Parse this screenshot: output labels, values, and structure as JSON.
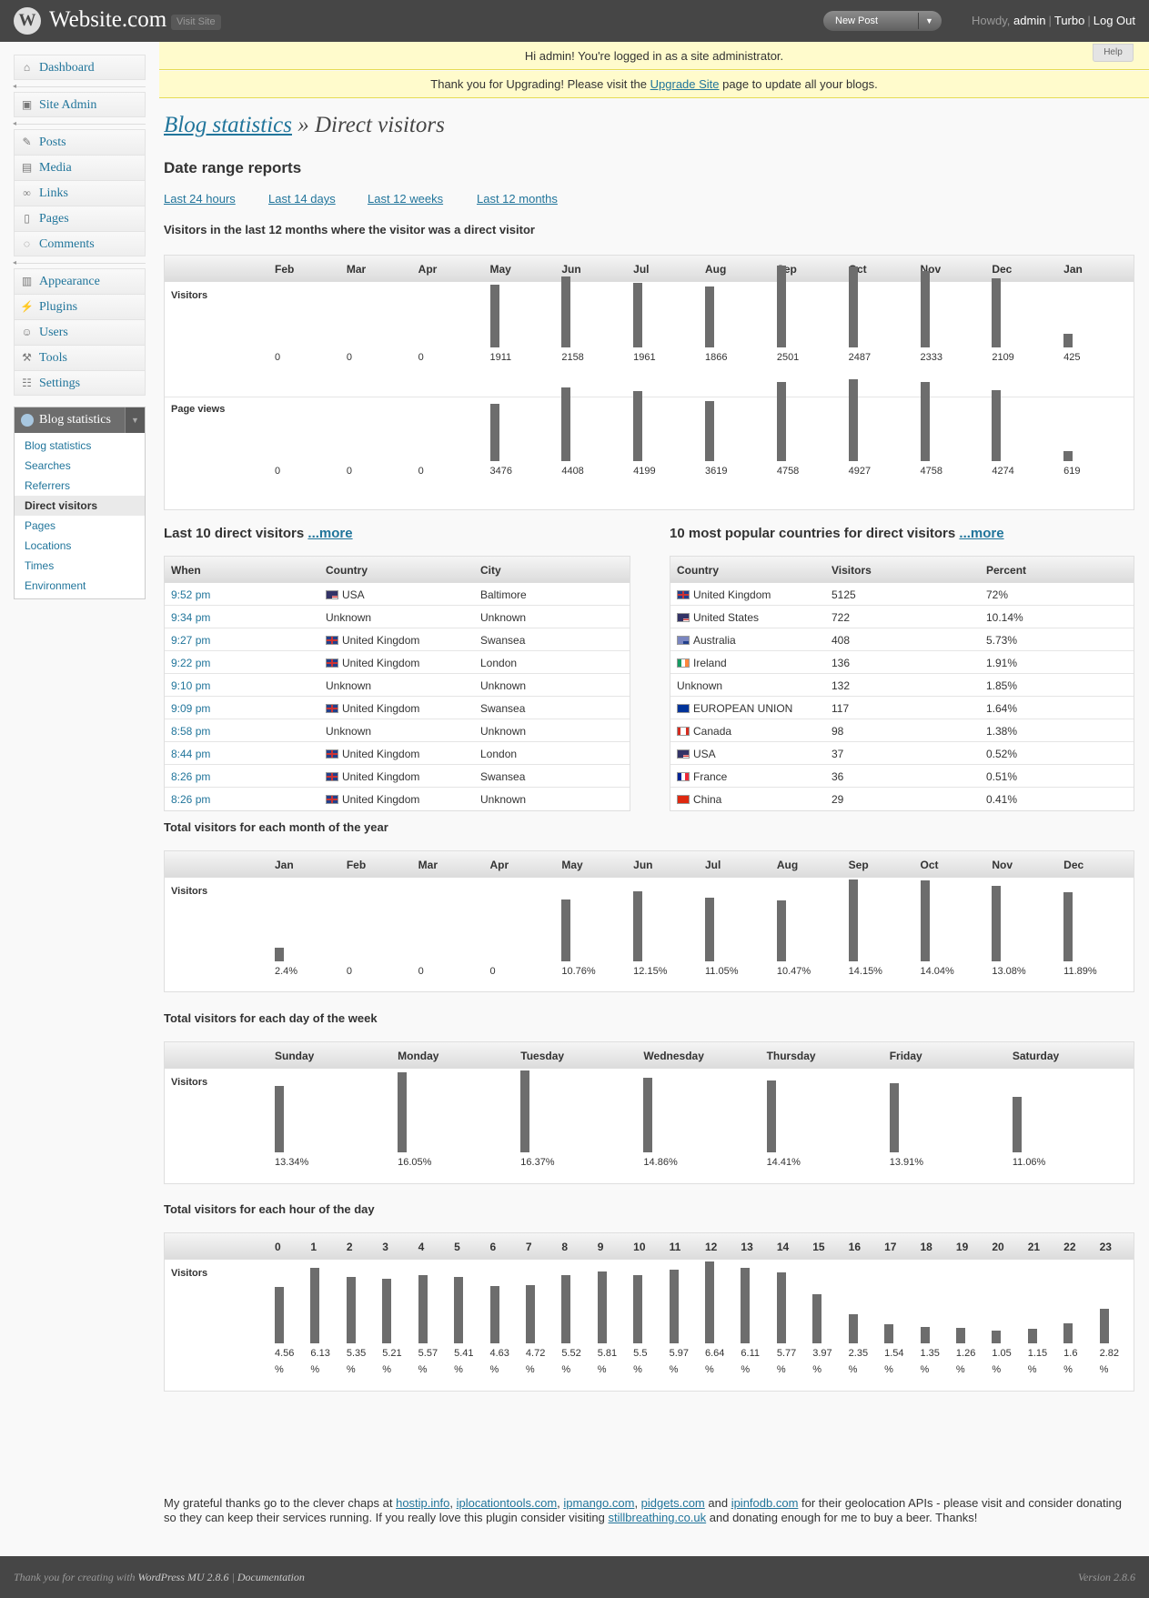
{
  "header": {
    "logo": "W",
    "site_title": "Website.com",
    "visit_site": "Visit Site",
    "new_post": "New Post",
    "howdy": "Howdy,",
    "user": "admin",
    "turbo": "Turbo",
    "logout": "Log Out"
  },
  "nav": {
    "dashboard": "Dashboard",
    "site_admin": "Site Admin",
    "posts": "Posts",
    "media": "Media",
    "links": "Links",
    "pages": "Pages",
    "comments": "Comments",
    "appearance": "Appearance",
    "plugins": "Plugins",
    "users": "Users",
    "tools": "Tools",
    "settings": "Settings",
    "blog_statistics": "Blog statistics",
    "sub": [
      "Blog statistics",
      "Searches",
      "Referrers",
      "Direct visitors",
      "Pages",
      "Locations",
      "Times",
      "Environment"
    ]
  },
  "notices": {
    "admin": "Hi admin! You're logged in as a site administrator.",
    "upgrade_pre": "Thank you for Upgrading! Please visit the ",
    "upgrade_link": "Upgrade Site",
    "upgrade_post": " page to update all your blogs.",
    "help": "Help"
  },
  "page": {
    "title_link": "Blog statistics",
    "title_rest": " » Direct visitors",
    "date_range_heading": "Date range reports",
    "ranges": [
      "Last 24 hours",
      "Last 14 days",
      "Last 12 weeks",
      "Last 12 months"
    ],
    "chart1_heading": "Visitors in the last 12 months where the visitor was a direct visitor",
    "last10_heading": "Last 10 direct visitors ",
    "countries_heading": "10 most popular countries for direct visitors ",
    "more": "...more",
    "month_heading": "Total visitors for each month of the year",
    "week_heading": "Total visitors for each day of the week",
    "hour_heading": "Total visitors for each hour of the day",
    "visitors_label": "Visitors",
    "pageviews_label": "Page views"
  },
  "chart_data": [
    {
      "type": "bar",
      "categories": [
        "Feb",
        "Mar",
        "Apr",
        "May",
        "Jun",
        "Jul",
        "Aug",
        "Sep",
        "Oct",
        "Nov",
        "Dec",
        "Jan"
      ],
      "series": [
        {
          "name": "Visitors",
          "values": [
            0,
            0,
            0,
            1911,
            2158,
            1961,
            1866,
            2501,
            2487,
            2333,
            2109,
            425
          ]
        },
        {
          "name": "Page views",
          "values": [
            0,
            0,
            0,
            3476,
            4408,
            4199,
            3619,
            4758,
            4927,
            4758,
            4274,
            619
          ]
        }
      ]
    },
    {
      "type": "bar",
      "categories": [
        "Jan",
        "Feb",
        "Mar",
        "Apr",
        "May",
        "Jun",
        "Jul",
        "Aug",
        "Sep",
        "Oct",
        "Nov",
        "Dec"
      ],
      "series": [
        {
          "name": "Visitors",
          "values": [
            2.4,
            0,
            0,
            0,
            10.76,
            12.15,
            11.05,
            10.47,
            14.15,
            14.04,
            13.08,
            11.89
          ],
          "labels": [
            "2.4%",
            "0",
            "0",
            "0",
            "10.76%",
            "12.15%",
            "11.05%",
            "10.47%",
            "14.15%",
            "14.04%",
            "13.08%",
            "11.89%"
          ]
        }
      ]
    },
    {
      "type": "bar",
      "categories": [
        "Sunday",
        "Monday",
        "Tuesday",
        "Wednesday",
        "Thursday",
        "Friday",
        "Saturday"
      ],
      "series": [
        {
          "name": "Visitors",
          "values": [
            13.34,
            16.05,
            16.37,
            14.86,
            14.41,
            13.91,
            11.06
          ],
          "labels": [
            "13.34%",
            "16.05%",
            "16.37%",
            "14.86%",
            "14.41%",
            "13.91%",
            "11.06%"
          ]
        }
      ]
    },
    {
      "type": "bar",
      "categories": [
        "0",
        "1",
        "2",
        "3",
        "4",
        "5",
        "6",
        "7",
        "8",
        "9",
        "10",
        "11",
        "12",
        "13",
        "14",
        "15",
        "16",
        "17",
        "18",
        "19",
        "20",
        "21",
        "22",
        "23"
      ],
      "series": [
        {
          "name": "Visitors",
          "values": [
            4.56,
            6.13,
            5.35,
            5.21,
            5.57,
            5.41,
            4.63,
            4.72,
            5.52,
            5.81,
            5.5,
            5.97,
            6.64,
            6.11,
            5.77,
            3.97,
            2.35,
            1.54,
            1.35,
            1.26,
            1.05,
            1.15,
            1.6,
            2.82
          ]
        }
      ]
    }
  ],
  "last_visitors": {
    "columns": [
      "When",
      "Country",
      "City"
    ],
    "rows": [
      {
        "when": "9:52 pm",
        "flag": "us",
        "country": "USA",
        "city": "Baltimore"
      },
      {
        "when": "9:34 pm",
        "flag": "",
        "country": "Unknown",
        "city": "Unknown"
      },
      {
        "when": "9:27 pm",
        "flag": "uk",
        "country": "United Kingdom",
        "city": "Swansea"
      },
      {
        "when": "9:22 pm",
        "flag": "uk",
        "country": "United Kingdom",
        "city": "London"
      },
      {
        "when": "9:10 pm",
        "flag": "",
        "country": "Unknown",
        "city": "Unknown"
      },
      {
        "when": "9:09 pm",
        "flag": "uk",
        "country": "United Kingdom",
        "city": "Swansea"
      },
      {
        "when": "8:58 pm",
        "flag": "",
        "country": "Unknown",
        "city": "Unknown"
      },
      {
        "when": "8:44 pm",
        "flag": "uk",
        "country": "United Kingdom",
        "city": "London"
      },
      {
        "when": "8:26 pm",
        "flag": "uk",
        "country": "United Kingdom",
        "city": "Swansea"
      },
      {
        "when": "8:26 pm",
        "flag": "uk",
        "country": "United Kingdom",
        "city": "Unknown"
      }
    ]
  },
  "countries": {
    "columns": [
      "Country",
      "Visitors",
      "Percent"
    ],
    "rows": [
      {
        "flag": "uk",
        "country": "United Kingdom",
        "visitors": "5125",
        "percent": "72%"
      },
      {
        "flag": "us",
        "country": "United States",
        "visitors": "722",
        "percent": "10.14%"
      },
      {
        "flag": "au",
        "country": "Australia",
        "visitors": "408",
        "percent": "5.73%"
      },
      {
        "flag": "ie",
        "country": "Ireland",
        "visitors": "136",
        "percent": "1.91%"
      },
      {
        "flag": "",
        "country": "Unknown",
        "visitors": "132",
        "percent": "1.85%"
      },
      {
        "flag": "eu",
        "country": "EUROPEAN UNION",
        "visitors": "117",
        "percent": "1.64%"
      },
      {
        "flag": "ca",
        "country": "Canada",
        "visitors": "98",
        "percent": "1.38%"
      },
      {
        "flag": "us",
        "country": "USA",
        "visitors": "37",
        "percent": "0.52%"
      },
      {
        "flag": "fr",
        "country": "France",
        "visitors": "36",
        "percent": "0.51%"
      },
      {
        "flag": "cn",
        "country": "China",
        "visitors": "29",
        "percent": "0.41%"
      }
    ]
  },
  "thanks": {
    "t1": "My grateful thanks go to the clever chaps at ",
    "l1": "hostip.info",
    "l2": "iplocationtools.com",
    "l3": "ipmango.com",
    "l4": "pidgets.com",
    "and": " and ",
    "l5": "ipinfodb.com",
    "t2": " for their geolocation APIs - please visit and consider donating so they can keep their services running. If you really love this plugin consider visiting ",
    "l6": "stillbreathing.co.uk",
    "t3": " and donating enough for me to buy a beer. Thanks!"
  },
  "footer": {
    "pre": "Thank you for creating with ",
    "wpmu": "WordPress MU 2.8.6",
    "docs": "Documentation",
    "version": "Version 2.8.6"
  },
  "colors": {
    "header": "#464646",
    "bar": "#6d6d6d",
    "link": "#21759b",
    "notice": "#fffbcc"
  }
}
